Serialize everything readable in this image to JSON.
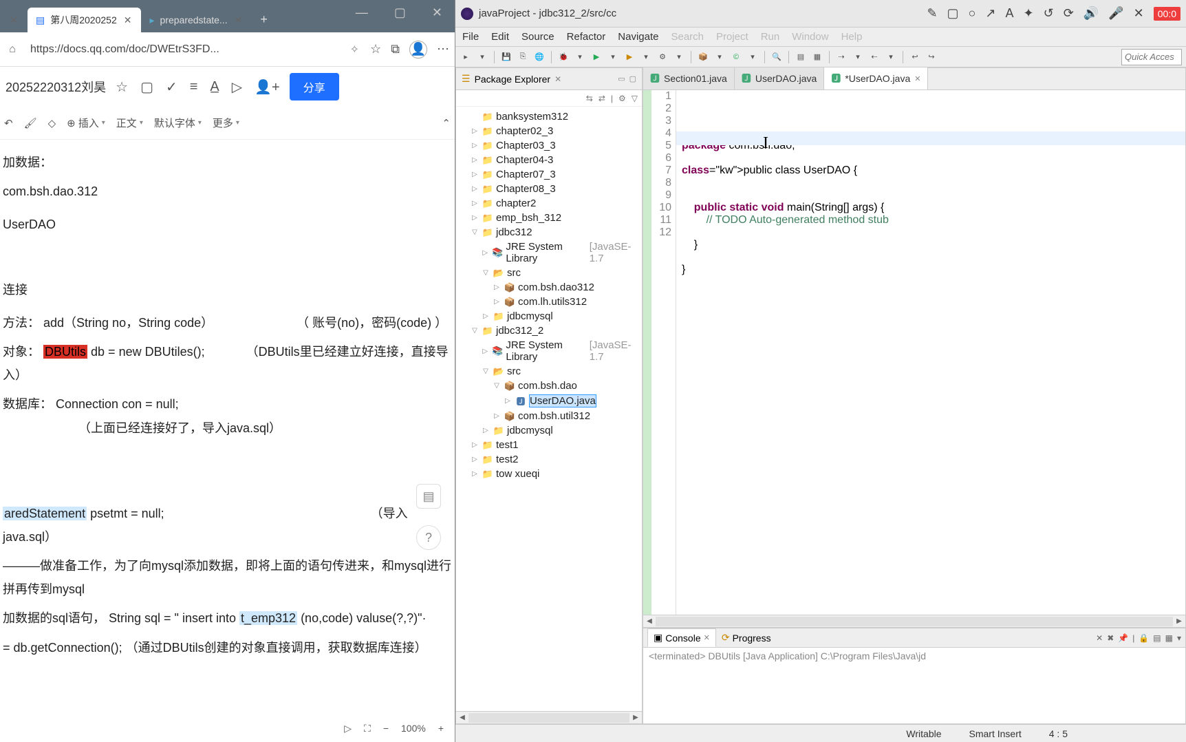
{
  "browser": {
    "tabs": [
      {
        "label": "",
        "active": false
      },
      {
        "label": "第八周2020252",
        "active": true
      },
      {
        "label": "preparedstate...",
        "active": false
      }
    ],
    "url": "https://docs.qq.com/doc/DWEtrS3FD...",
    "controls": {
      "min": "—",
      "max": "▢",
      "close": "✕"
    }
  },
  "doc": {
    "title": "20252220312刘昊",
    "share": "分享",
    "toolbar": {
      "insert": "插入",
      "body": "正文",
      "font": "默认字体",
      "more": "更多"
    },
    "content": {
      "l1": "加数据：",
      "l2": "com.bsh.dao.312",
      "l3": "UserDAO",
      "l4": "连接",
      "l5a": "方法：  add（String no，String code）",
      "l5b": "（   账号(no)，密码(code)  ）",
      "l6a": "对象：  ",
      "l6b": "DBUtils",
      "l6c": " db = new DBUtiles();",
      "l6d": "（DBUtils里已经建立好连接，直接导入）",
      "l7a": "数据库：  Connection  con   =   null;",
      "l7b": "（上面已经连接好了，导入java.sql）",
      "l8a": "aredStatement",
      "l8b": " psetmt = null;",
      "l8c": "（导入java.sql）",
      "l9": "———做准备工作，为了向mysql添加数据，即将上面的语句传进来，和mysql进行拼再传到mysql",
      "l10a": "加数据的sql语句，  String  sql  = \" insert  into   ",
      "l10b": "t_emp312",
      "l10c": "   (no,code)  valuse(?,?)\"·",
      "l11": " =  db.getConnection();           （通过DBUtils创建的对象直接调用，获取数据库连接）"
    },
    "footer": {
      "zoom": "100%"
    }
  },
  "eclipse": {
    "title": "javaProject - jdbc312_2/src/cc",
    "rec_time": "00:0",
    "menu": [
      "File",
      "Edit",
      "Source",
      "Refactor",
      "Navigate",
      "Search",
      "Project",
      "Run",
      "Window",
      "Help"
    ],
    "quick_access": "Quick Acces",
    "pkg_explorer": {
      "title": "Package Explorer",
      "items": [
        {
          "label": "banksystem312",
          "depth": 1,
          "type": "proj"
        },
        {
          "label": "chapter02_3",
          "depth": 1,
          "arrow": "▷",
          "type": "proj"
        },
        {
          "label": "Chapter03_3",
          "depth": 1,
          "arrow": "▷",
          "type": "proj"
        },
        {
          "label": "Chapter04-3",
          "depth": 1,
          "arrow": "▷",
          "type": "proj"
        },
        {
          "label": "Chapter07_3",
          "depth": 1,
          "arrow": "▷",
          "type": "proj"
        },
        {
          "label": "Chapter08_3",
          "depth": 1,
          "arrow": "▷",
          "type": "proj"
        },
        {
          "label": "chapter2",
          "depth": 1,
          "arrow": "▷",
          "type": "proj"
        },
        {
          "label": "emp_bsh_312",
          "depth": 1,
          "arrow": "▷",
          "type": "proj"
        },
        {
          "label": "jdbc312",
          "depth": 1,
          "arrow": "▽",
          "type": "proj"
        },
        {
          "label": "JRE System Library",
          "jre": " [JavaSE-1.7",
          "depth": 2,
          "arrow": "▷",
          "type": "jre"
        },
        {
          "label": "src",
          "depth": 2,
          "arrow": "▽",
          "type": "src"
        },
        {
          "label": "com.bsh.dao312",
          "depth": 3,
          "arrow": "▷",
          "type": "pkg"
        },
        {
          "label": "com.lh.utils312",
          "depth": 3,
          "arrow": "▷",
          "type": "pkg"
        },
        {
          "label": "jdbcmysql",
          "depth": 2,
          "arrow": "▷",
          "type": "proj"
        },
        {
          "label": "jdbc312_2",
          "depth": 1,
          "arrow": "▽",
          "type": "proj"
        },
        {
          "label": "JRE System Library",
          "jre": " [JavaSE-1.7",
          "depth": 2,
          "arrow": "▷",
          "type": "jre"
        },
        {
          "label": "src",
          "depth": 2,
          "arrow": "▽",
          "type": "src"
        },
        {
          "label": "com.bsh.dao",
          "depth": 3,
          "arrow": "▽",
          "type": "pkg"
        },
        {
          "label": "UserDAO.java",
          "depth": 4,
          "arrow": "▷",
          "type": "java",
          "sel": true
        },
        {
          "label": "com.bsh.util312",
          "depth": 3,
          "arrow": "▷",
          "type": "pkg"
        },
        {
          "label": "jdbcmysql",
          "depth": 2,
          "arrow": "▷",
          "type": "proj"
        },
        {
          "label": "test1",
          "depth": 1,
          "arrow": "▷",
          "type": "proj"
        },
        {
          "label": "test2",
          "depth": 1,
          "arrow": "▷",
          "type": "proj"
        },
        {
          "label": "tow xueqi",
          "depth": 1,
          "arrow": "▷",
          "type": "proj"
        }
      ]
    },
    "editor": {
      "tabs": [
        {
          "label": "Section01.java"
        },
        {
          "label": "UserDAO.java"
        },
        {
          "label": "*UserDAO.java",
          "active": true
        }
      ],
      "lines": [
        {
          "n": 1,
          "t": "package com.bsh.dao;",
          "k": [
            "package"
          ]
        },
        {
          "n": 2,
          "t": ""
        },
        {
          "n": 3,
          "t": "public class UserDAO {",
          "k": [
            "public",
            "class"
          ]
        },
        {
          "n": 4,
          "t": ""
        },
        {
          "n": 5,
          "t": ""
        },
        {
          "n": 6,
          "t": "    public static void main(String[] args) {",
          "k": [
            "public",
            "static",
            "void"
          ]
        },
        {
          "n": 7,
          "t": "        // TODO Auto-generated method stub",
          "cm": true
        },
        {
          "n": 8,
          "t": ""
        },
        {
          "n": 9,
          "t": "    }"
        },
        {
          "n": 10,
          "t": ""
        },
        {
          "n": 11,
          "t": "}"
        },
        {
          "n": 12,
          "t": ""
        }
      ]
    },
    "console": {
      "tabs": [
        {
          "label": "Console",
          "active": true
        },
        {
          "label": "Progress"
        }
      ],
      "text": "<terminated> DBUtils [Java Application] C:\\Program Files\\Java\\jd"
    },
    "status": {
      "writable": "Writable",
      "insert": "Smart Insert",
      "pos": "4 : 5"
    }
  }
}
